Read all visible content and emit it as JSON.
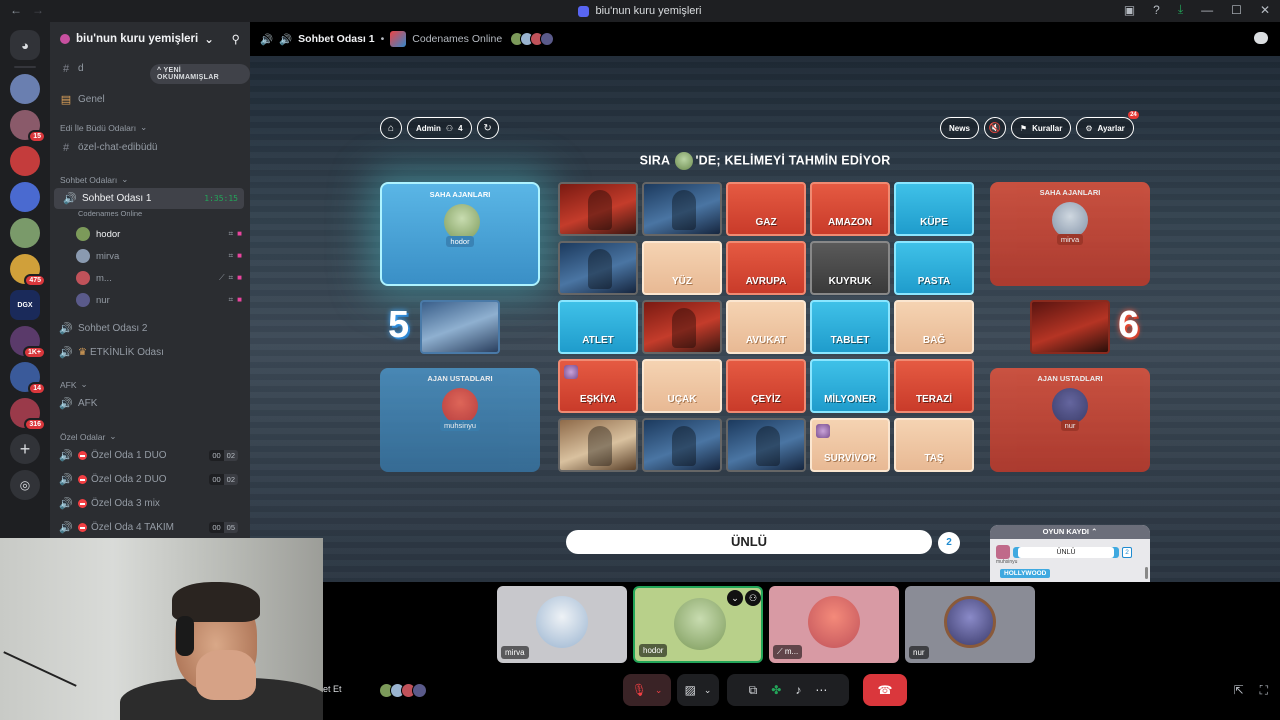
{
  "window": {
    "title": "biu'nun kuru yemişleri"
  },
  "server": {
    "name": "biu'nun kuru yemişleri",
    "unread_pill": "YENİ OKUNMAMIŞLAR"
  },
  "rail_badges": [
    "15",
    "475",
    "1K+",
    "14",
    "316"
  ],
  "rail_label": "DGX",
  "channels": {
    "top_channel": "d",
    "genel": "Genel",
    "cat_edi": "Edi İle Büdü Odaları",
    "ozel_chat": "özel-chat-edibüdü",
    "cat_sohbet": "Sohbet Odaları",
    "sohbet1": "Sohbet Odası 1",
    "sohbet1_timer": "1:35:15",
    "sohbet1_activity": "Codenames Online",
    "users": [
      {
        "name": "hodor",
        "color": "#7c9a5a"
      },
      {
        "name": "mirva",
        "color": "#8a9ab0"
      },
      {
        "name": "m...",
        "color": "#c0525a"
      },
      {
        "name": "nur",
        "color": "#5a5a8a"
      }
    ],
    "sohbet2": "Sohbet Odası 2",
    "etkinlik": "ETKİNLİK Odası",
    "cat_afk": "AFK",
    "afk": "AFK",
    "cat_ozel": "Özel Odalar",
    "ozel_rooms": [
      {
        "name": "Özel Oda 1 DUO",
        "a": "00",
        "b": "02"
      },
      {
        "name": "Özel Oda 2 DUO",
        "a": "00",
        "b": "02"
      },
      {
        "name": "Özel Oda 3 mix",
        "a": "",
        "b": ""
      },
      {
        "name": "Özel Oda 4 TAKIM",
        "a": "00",
        "b": "05"
      }
    ]
  },
  "stage": {
    "channel": "Sohbet Odası 1",
    "activity": "Codenames Online"
  },
  "game": {
    "admin_label": "Admin",
    "player_count": "4",
    "news_label": "News",
    "news_badge": "24",
    "rules_label": "Kurallar",
    "settings_label": "Ayarlar",
    "turn_prefix": "SIRA",
    "turn_suffix": "'DE; KELİMEYİ TAHMİN EDİYOR",
    "blue": {
      "operatives_title": "SAHA AJANLARI",
      "operative": "hodor",
      "score": "5",
      "spymasters_title": "AJAN USTADLARI",
      "spymaster": "muhsinyu"
    },
    "red": {
      "operatives_title": "SAHA AJANLARI",
      "operative": "mirva",
      "score": "6",
      "spymasters_title": "AJAN USTADLARI",
      "spymaster": "nur"
    },
    "cards": [
      {
        "word": "",
        "kind": "pic redpic"
      },
      {
        "word": "",
        "kind": "pic bluepic"
      },
      {
        "word": "GAZ",
        "kind": "red"
      },
      {
        "word": "AMAZON",
        "kind": "red"
      },
      {
        "word": "KÜPE",
        "kind": "blue"
      },
      {
        "word": "",
        "kind": "pic bluepic"
      },
      {
        "word": "YÜZ",
        "kind": "neutral"
      },
      {
        "word": "AVRUPA",
        "kind": "red"
      },
      {
        "word": "KUYRUK",
        "kind": "assassin"
      },
      {
        "word": "PASTA",
        "kind": "blue"
      },
      {
        "word": "ATLET",
        "kind": "blue"
      },
      {
        "word": "",
        "kind": "pic redpic"
      },
      {
        "word": "AVUKAT",
        "kind": "neutral"
      },
      {
        "word": "TABLET",
        "kind": "blue"
      },
      {
        "word": "BAĞ",
        "kind": "neutral"
      },
      {
        "word": "EŞKİYA",
        "kind": "red",
        "marked": true
      },
      {
        "word": "UÇAK",
        "kind": "neutral"
      },
      {
        "word": "ÇEYİZ",
        "kind": "red"
      },
      {
        "word": "MİLYONER",
        "kind": "blue"
      },
      {
        "word": "TERAZİ",
        "kind": "red"
      },
      {
        "word": "",
        "kind": "pic neupic"
      },
      {
        "word": "",
        "kind": "pic bluepic"
      },
      {
        "word": "",
        "kind": "pic bluepic"
      },
      {
        "word": "SURVİVOR",
        "kind": "neutral",
        "marked": true
      },
      {
        "word": "TAŞ",
        "kind": "neutral"
      }
    ],
    "clue_word": "ÜNLÜ",
    "clue_number": "2",
    "log": {
      "title": "OYUN KAYDI",
      "entry_word": "ÜNLÜ",
      "entry_number": "2",
      "entry_user": "muhsinyu",
      "guess": "HOLLYWOOD"
    }
  },
  "tiles": [
    {
      "name": "mirva",
      "bg": "#c8c8cc",
      "ava": "#9ab4d0",
      "speaking": false
    },
    {
      "name": "hodor",
      "bg": "#b8d08a",
      "ava": "#7c9a5a",
      "speaking": true
    },
    {
      "name": "m...",
      "bg": "#d89aa4",
      "ava": "#c0525a",
      "speaking": false
    },
    {
      "name": "nur",
      "bg": "#8a8c96",
      "ava": "#5a5a8a",
      "speaking": false
    }
  ],
  "bottombar": {
    "label": "et Et"
  },
  "colors": {
    "blue_team": "#3fc1e8",
    "red_team": "#e55a42",
    "discord_bg": "#2b2d31",
    "accent": "#5865f2"
  }
}
